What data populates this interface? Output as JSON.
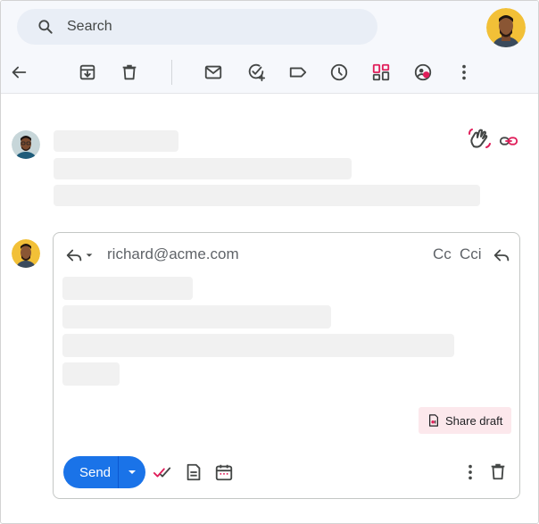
{
  "search": {
    "placeholder": "Search"
  },
  "toolbar": {
    "icons": [
      "back-arrow-icon",
      "archive-icon",
      "delete-icon",
      "mail-icon",
      "add-task-icon",
      "label-icon",
      "snooze-icon",
      "apps-grid-icon",
      "collaborator-icon",
      "more-vert-icon"
    ]
  },
  "thread_actions": {
    "icons": [
      "wave-hand-icon",
      "link-icon"
    ]
  },
  "compose": {
    "to_address": "richard@acme.com",
    "cc_label": "Cc",
    "cci_label": "Cci",
    "share_draft_label": "Share draft",
    "send_label": "Send"
  },
  "colors": {
    "accent_blue": "#1a73e8",
    "accent_red": "#e01e5a",
    "search_bg": "#e9eef6",
    "skeleton": "#f1f1f1",
    "share_bg": "#fce8ec"
  }
}
